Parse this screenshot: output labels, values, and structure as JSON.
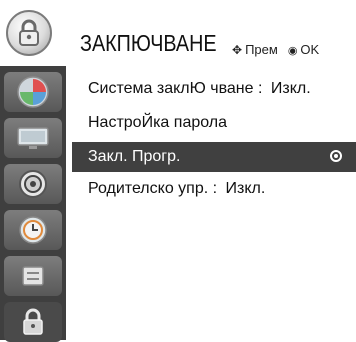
{
  "header": {
    "title": "ЗАКПЮЧВАНЕ",
    "nav_hint_glyph": "✥",
    "nav_hint_label": "Прем",
    "ok_glyph": "◉",
    "ok_label": "OK"
  },
  "sidebar": {
    "items": [
      {
        "name": "picture-icon"
      },
      {
        "name": "tv-icon"
      },
      {
        "name": "audio-icon"
      },
      {
        "name": "clock-icon"
      },
      {
        "name": "options-icon"
      },
      {
        "name": "lock-icon"
      }
    ],
    "active_index": 5
  },
  "menu": {
    "rows": [
      {
        "label": "Система заклЮ чване",
        "separator": ":",
        "value": "Изкл."
      },
      {
        "label": "НастроЙка парола",
        "separator": "",
        "value": ""
      },
      {
        "label": "Закл. Прогр.",
        "separator": "",
        "value": ""
      },
      {
        "label": "Родителско упр.",
        "separator": ":",
        "value": "Изкл."
      }
    ],
    "selected_index": 2
  }
}
